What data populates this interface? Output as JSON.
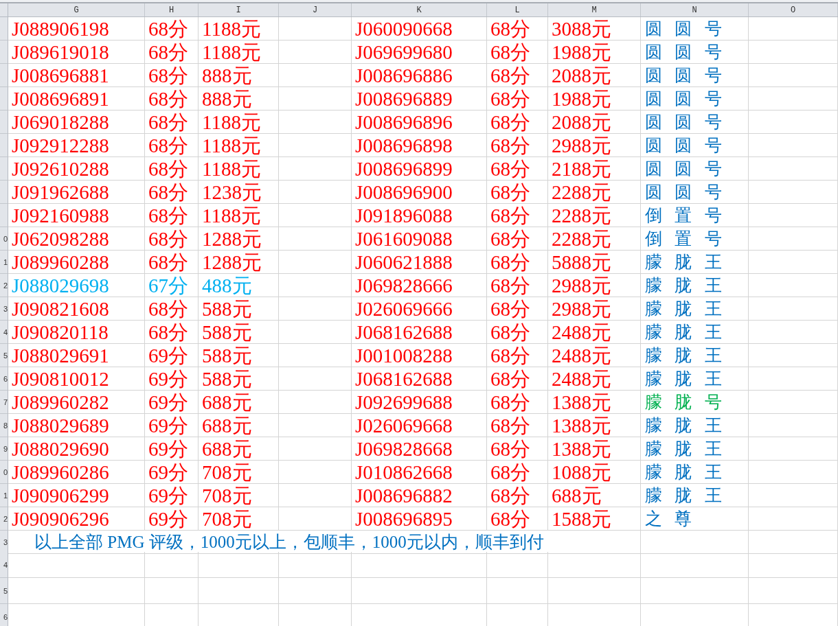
{
  "columns": [
    "G",
    "H",
    "I",
    "J",
    "K",
    "L",
    "M",
    "N",
    "O"
  ],
  "rows": [
    {
      "left": {
        "code": "J088906198",
        "score": "68分",
        "price": "1188元",
        "color": "#ff0000"
      },
      "right": {
        "code": "J060090668",
        "score": "68分",
        "price": "3088元"
      },
      "note": {
        "text": "圆 圆 号",
        "color": "#0070c0"
      }
    },
    {
      "left": {
        "code": "J089619018",
        "score": "68分",
        "price": "1188元",
        "color": "#ff0000"
      },
      "right": {
        "code": "J069699680",
        "score": "68分",
        "price": "1988元"
      },
      "note": {
        "text": "圆 圆 号",
        "color": "#0070c0"
      }
    },
    {
      "left": {
        "code": "J008696881",
        "score": "68分",
        "price": "888元",
        "color": "#ff0000"
      },
      "right": {
        "code": "J008696886",
        "score": "68分",
        "price": "2088元"
      },
      "note": {
        "text": "圆 圆 号",
        "color": "#0070c0"
      }
    },
    {
      "left": {
        "code": "J008696891",
        "score": "68分",
        "price": "888元",
        "color": "#ff0000"
      },
      "right": {
        "code": "J008696889",
        "score": "68分",
        "price": "1988元"
      },
      "note": {
        "text": "圆 圆 号",
        "color": "#0070c0"
      }
    },
    {
      "left": {
        "code": "J069018288",
        "score": "68分",
        "price": "1188元",
        "color": "#ff0000"
      },
      "right": {
        "code": "J008696896",
        "score": "68分",
        "price": "2088元"
      },
      "note": {
        "text": "圆 圆 号",
        "color": "#0070c0"
      }
    },
    {
      "left": {
        "code": "J092912288",
        "score": "68分",
        "price": "1188元",
        "color": "#ff0000"
      },
      "right": {
        "code": "J008696898",
        "score": "68分",
        "price": "2988元"
      },
      "note": {
        "text": "圆 圆 号",
        "color": "#0070c0"
      }
    },
    {
      "left": {
        "code": "J092610288",
        "score": "68分",
        "price": "1188元",
        "color": "#ff0000"
      },
      "right": {
        "code": "J008696899",
        "score": "68分",
        "price": "2188元"
      },
      "note": {
        "text": "圆 圆 号",
        "color": "#0070c0"
      }
    },
    {
      "left": {
        "code": "J091962688",
        "score": "68分",
        "price": "1238元",
        "color": "#ff0000"
      },
      "right": {
        "code": "J008696900",
        "score": "68分",
        "price": "2288元"
      },
      "note": {
        "text": "圆 圆 号",
        "color": "#0070c0"
      }
    },
    {
      "left": {
        "code": "J092160988",
        "score": "68分",
        "price": "1188元",
        "color": "#ff0000"
      },
      "right": {
        "code": "J091896088",
        "score": "68分",
        "price": "2288元"
      },
      "note": {
        "text": "倒 置 号",
        "color": "#0070c0"
      }
    },
    {
      "row_label": "0",
      "left": {
        "code": "J062098288",
        "score": "68分",
        "price": "1288元",
        "color": "#ff0000"
      },
      "right": {
        "code": "J061609088",
        "score": "68分",
        "price": "2288元"
      },
      "note": {
        "text": "倒 置 号",
        "color": "#0070c0"
      }
    },
    {
      "row_label": "1",
      "left": {
        "code": "J089960288",
        "score": "68分",
        "price": "1288元",
        "color": "#ff0000"
      },
      "right": {
        "code": "J060621888",
        "score": "68分",
        "price": "5888元"
      },
      "note": {
        "text": "朦 胧 王",
        "color": "#0070c0"
      }
    },
    {
      "row_label": "2",
      "left": {
        "code": "J088029698",
        "score": "67分",
        "price": "488元",
        "color": "#00b0f0"
      },
      "right": {
        "code": "J069828666",
        "score": "68分",
        "price": "2988元"
      },
      "note": {
        "text": "朦 胧 王",
        "color": "#0070c0"
      }
    },
    {
      "row_label": "3",
      "left": {
        "code": "J090821608",
        "score": "68分",
        "price": "588元",
        "color": "#ff0000"
      },
      "right": {
        "code": "J026069666",
        "score": "68分",
        "price": "2988元"
      },
      "note": {
        "text": "朦 胧 王",
        "color": "#0070c0"
      }
    },
    {
      "row_label": "4",
      "left": {
        "code": "J090820118",
        "score": "68分",
        "price": "588元",
        "color": "#ff0000"
      },
      "right": {
        "code": "J068162688",
        "score": "68分",
        "price": "2488元"
      },
      "note": {
        "text": "朦 胧 王",
        "color": "#0070c0"
      }
    },
    {
      "row_label": "5",
      "left": {
        "code": "J088029691",
        "score": "69分",
        "price": "588元",
        "color": "#ff0000"
      },
      "right": {
        "code": "J001008288",
        "score": "68分",
        "price": "2488元"
      },
      "note": {
        "text": "朦 胧 王",
        "color": "#0070c0"
      }
    },
    {
      "row_label": "6",
      "left": {
        "code": "J090810012",
        "score": "69分",
        "price": "588元",
        "color": "#ff0000"
      },
      "right": {
        "code": "J068162688",
        "score": "68分",
        "price": "2488元"
      },
      "note": {
        "text": "朦 胧 王",
        "color": "#0070c0"
      }
    },
    {
      "row_label": "7",
      "left": {
        "code": "J089960282",
        "score": "69分",
        "price": "688元",
        "color": "#ff0000"
      },
      "right": {
        "code": "J092699688",
        "score": "68分",
        "price": "1388元"
      },
      "note": {
        "text": "朦 胧 号",
        "color": "#00b050"
      }
    },
    {
      "row_label": "8",
      "left": {
        "code": "J088029689",
        "score": "69分",
        "price": "688元",
        "color": "#ff0000"
      },
      "right": {
        "code": "J026069668",
        "score": "68分",
        "price": "1388元"
      },
      "note": {
        "text": "朦 胧 王",
        "color": "#0070c0"
      }
    },
    {
      "row_label": "9",
      "left": {
        "code": "J088029690",
        "score": "69分",
        "price": "688元",
        "color": "#ff0000"
      },
      "right": {
        "code": "J069828668",
        "score": "68分",
        "price": "1388元"
      },
      "note": {
        "text": "朦 胧 王",
        "color": "#0070c0"
      }
    },
    {
      "row_label": "0",
      "left": {
        "code": "J089960286",
        "score": "69分",
        "price": "708元",
        "color": "#ff0000"
      },
      "right": {
        "code": "J010862668",
        "score": "68分",
        "price": "1088元"
      },
      "note": {
        "text": "朦 胧 王",
        "color": "#0070c0"
      }
    },
    {
      "row_label": "1",
      "left": {
        "code": "J090906299",
        "score": "69分",
        "price": "708元",
        "color": "#ff0000"
      },
      "right": {
        "code": "J008696882",
        "score": "68分",
        "price": "688元"
      },
      "note": {
        "text": "朦 胧 王",
        "color": "#0070c0"
      }
    },
    {
      "row_label": "2",
      "left": {
        "code": "J090906296",
        "score": "69分",
        "price": "708元",
        "color": "#ff0000"
      },
      "right": {
        "code": "J008696895",
        "score": "68分",
        "price": "1588元"
      },
      "note": {
        "text": "之 尊",
        "color": "#0070c0"
      }
    }
  ],
  "footer": {
    "row_label": "3",
    "text": "以上全部 PMG 评级，1000元以上，包顺丰，1000元以内，顺丰到付"
  },
  "empty_rows": [
    {
      "row_label": "4"
    },
    {
      "row_label": "5"
    },
    {
      "row_label": "6"
    }
  ]
}
